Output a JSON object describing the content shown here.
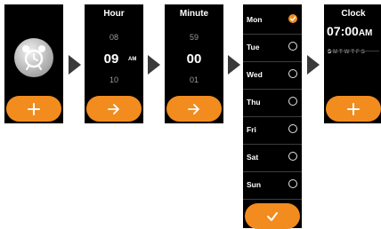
{
  "colors": {
    "accent": "#f28c1e",
    "screen": "#000000",
    "arrow": "#3a3a3a"
  },
  "step1": {
    "icon": "alarm-clock-icon",
    "button_icon": "plus-icon"
  },
  "hour": {
    "title": "Hour",
    "prev": "08",
    "current": "09",
    "period": "AM",
    "next": "10",
    "button_icon": "arrow-right-icon"
  },
  "minute": {
    "title": "Minute",
    "prev": "59",
    "current": "00",
    "next": "01",
    "button_icon": "arrow-right-icon"
  },
  "days": {
    "items": [
      {
        "label": "Mon",
        "selected": true
      },
      {
        "label": "Tue",
        "selected": false
      },
      {
        "label": "Wed",
        "selected": false
      },
      {
        "label": "Thu",
        "selected": false
      },
      {
        "label": "Fri",
        "selected": false
      },
      {
        "label": "Sat",
        "selected": false
      },
      {
        "label": "Sun",
        "selected": false
      }
    ],
    "button_icon": "check-icon"
  },
  "clock": {
    "title": "Clock",
    "time": "07:00",
    "period": "AM",
    "weekdays": [
      {
        "letter": "S",
        "active": true
      },
      {
        "letter": "M",
        "active": false
      },
      {
        "letter": "T",
        "active": false
      },
      {
        "letter": "W",
        "active": false
      },
      {
        "letter": "T",
        "active": false
      },
      {
        "letter": "F",
        "active": false
      },
      {
        "letter": "S",
        "active": false
      }
    ],
    "button_icon": "plus-icon"
  }
}
